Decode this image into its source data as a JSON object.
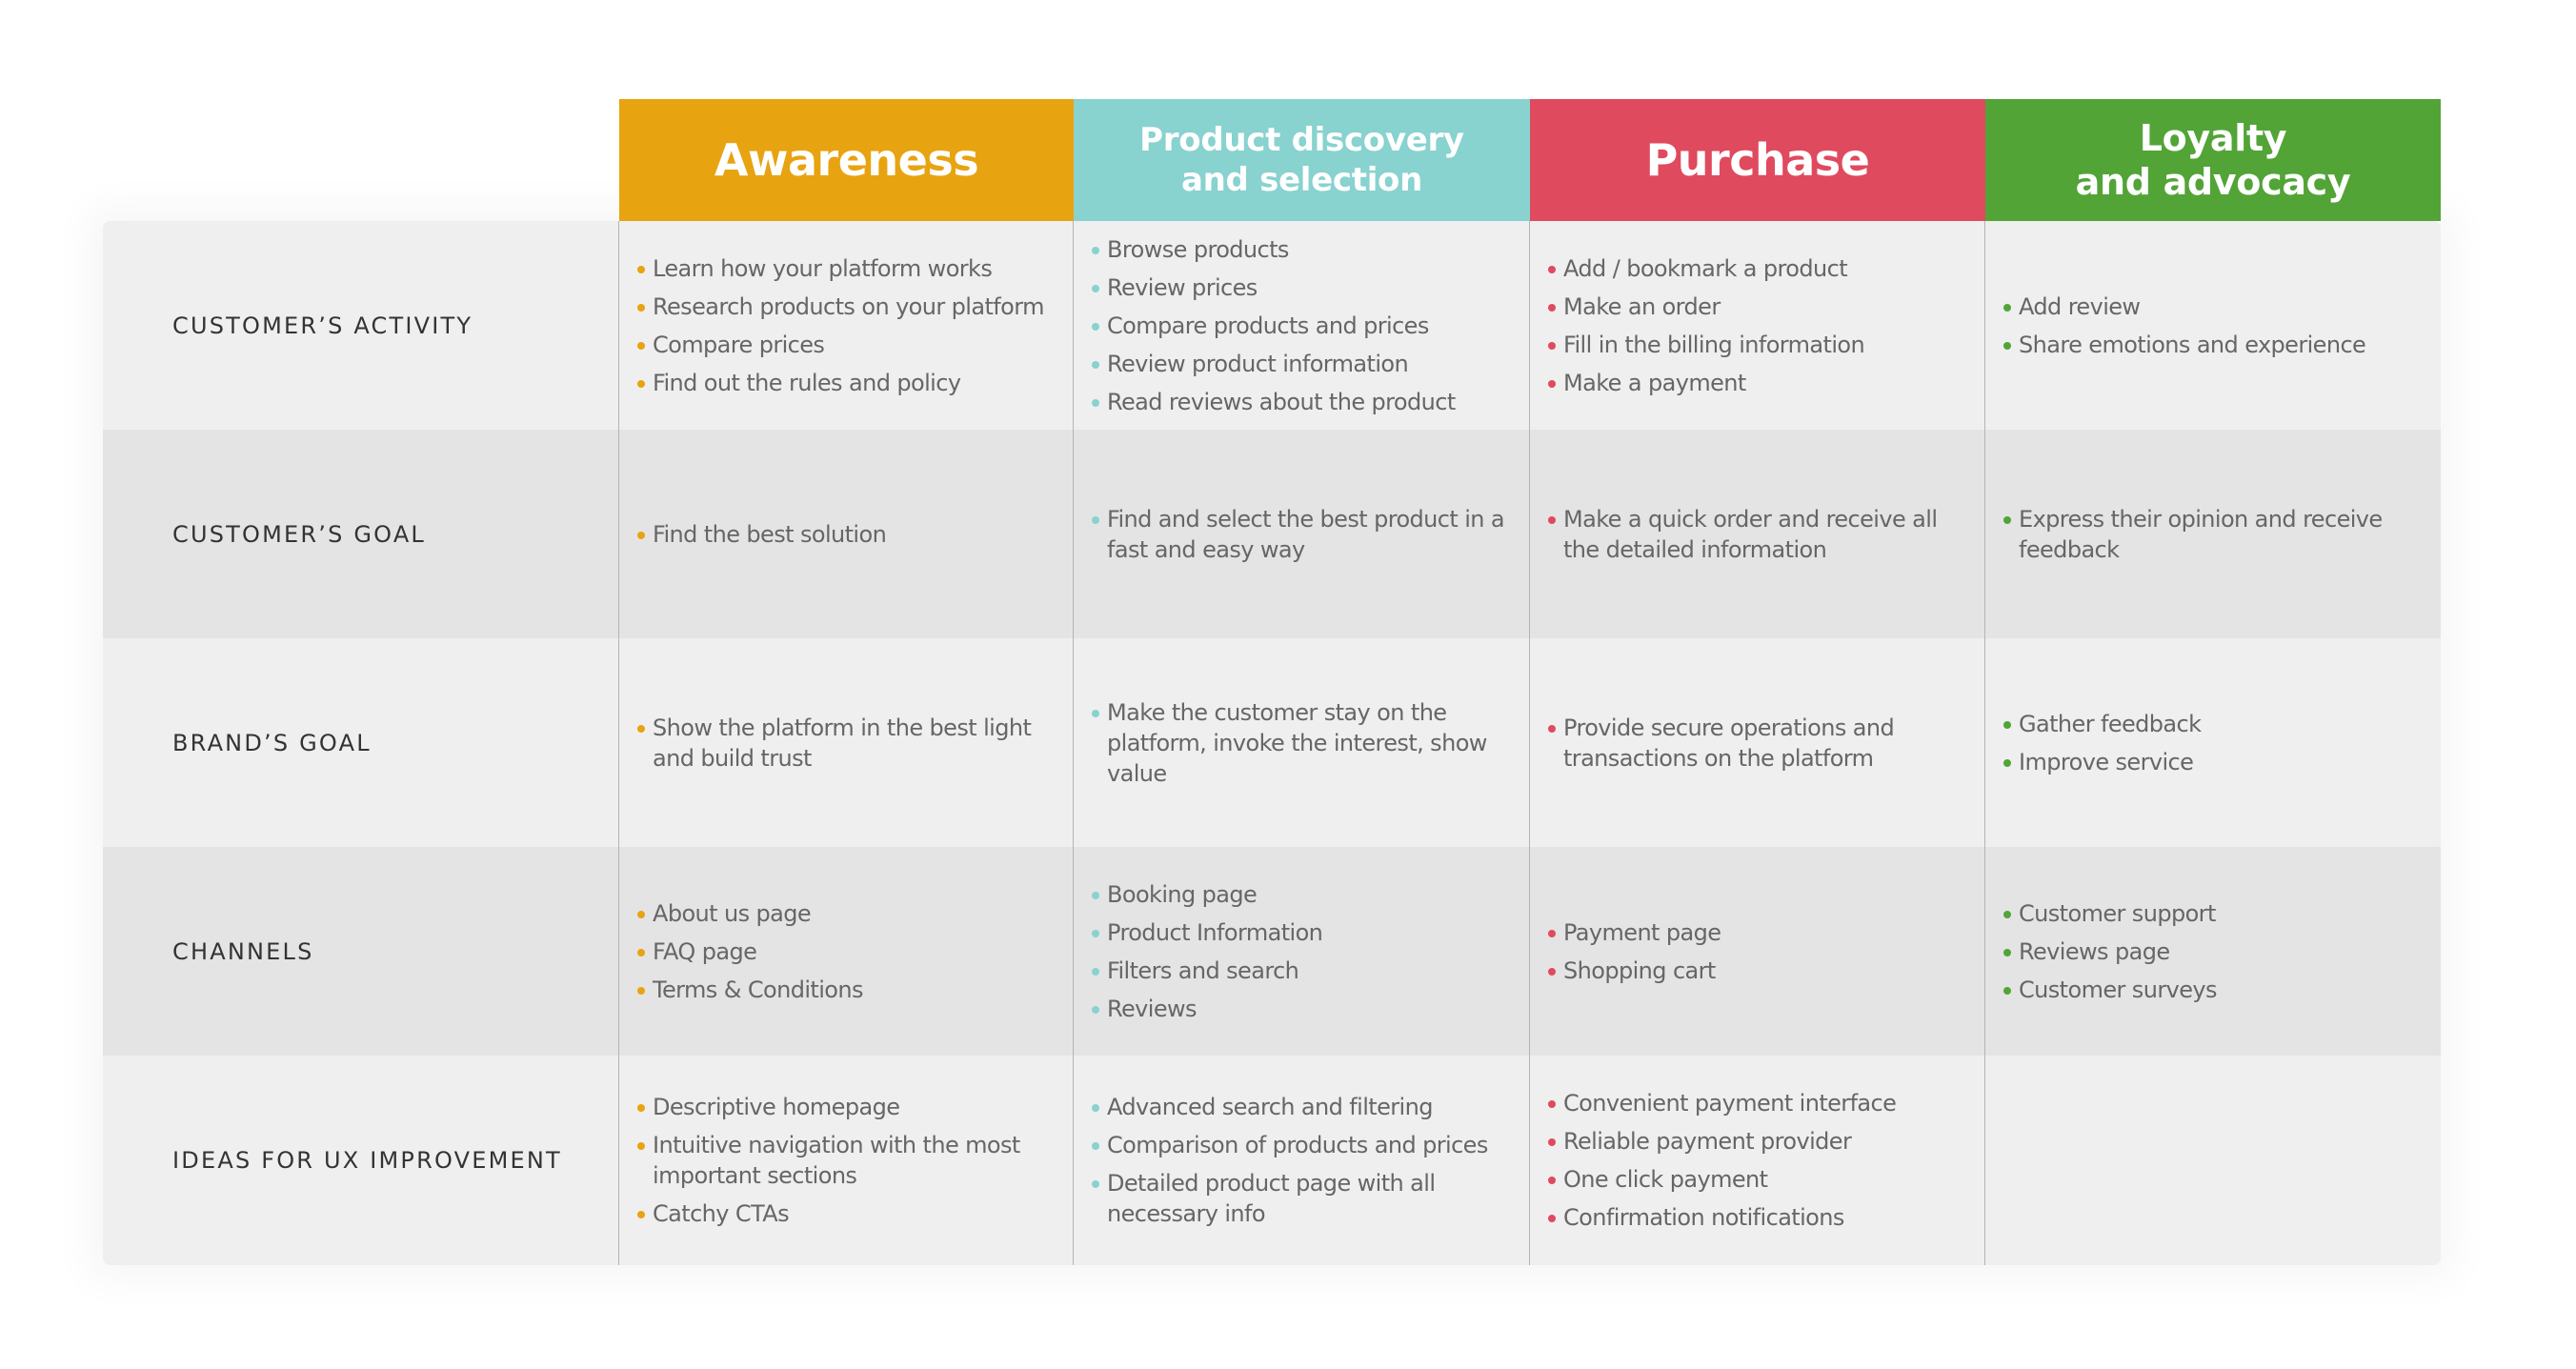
{
  "stages": [
    {
      "id": "awareness",
      "title": "Awareness",
      "color": "#e8a311",
      "size": "xl"
    },
    {
      "id": "discovery",
      "title": "Product discovery\nand selection",
      "color": "#88d2cf",
      "size": "md"
    },
    {
      "id": "purchase",
      "title": "Purchase",
      "color": "#e04a5e",
      "size": "xl"
    },
    {
      "id": "loyalty",
      "title": "Loyalty\nand advocacy",
      "color": "#52a437",
      "size": "lg"
    }
  ],
  "rows": [
    {
      "label": "CUSTOMER’S ACTIVITY",
      "cells": [
        [
          "Learn how your platform works",
          "Research products on your platform",
          "Compare prices",
          "Find out the rules and policy"
        ],
        [
          "Browse products",
          "Review prices",
          "Compare products and prices",
          "Review product information",
          "Read reviews about the product"
        ],
        [
          "Add / bookmark a product",
          "Make an order",
          "Fill in the billing information",
          "Make a payment"
        ],
        [
          "Add review",
          "Share emotions and experience"
        ]
      ]
    },
    {
      "label": "CUSTOMER’S GOAL",
      "cells": [
        [
          "Find the best solution"
        ],
        [
          "Find and select the best product in a fast and easy way"
        ],
        [
          "Make a quick order and receive all the detailed information"
        ],
        [
          "Express their opinion and receive feedback"
        ]
      ]
    },
    {
      "label": "BRAND’S GOAL",
      "cells": [
        [
          "Show the platform in the best light and build trust"
        ],
        [
          "Make the customer stay on the platform, invoke the interest, show value"
        ],
        [
          "Provide secure operations and transactions on the platform"
        ],
        [
          "Gather feedback",
          "Improve service"
        ]
      ]
    },
    {
      "label": "CHANNELS",
      "cells": [
        [
          "About us page",
          "FAQ page",
          "Terms & Conditions"
        ],
        [
          "Booking page",
          "Product Information",
          "Filters and search",
          "Reviews"
        ],
        [
          "Payment page",
          "Shopping cart"
        ],
        [
          "Customer support",
          "Reviews page",
          "Customer surveys"
        ]
      ]
    },
    {
      "label": "IDEAS FOR UX IMPROVEMENT",
      "cells": [
        [
          "Descriptive homepage",
          "Intuitive navigation with the most important sections",
          "Catchy CTAs"
        ],
        [
          "Advanced search and filtering",
          "Comparison of products and prices",
          "Detailed product page with all necessary info"
        ],
        [
          "Convenient payment interface",
          "Reliable payment provider",
          "One click payment",
          "Confirmation notifications"
        ],
        []
      ]
    }
  ],
  "colors": {
    "row_light": "#efefef",
    "row_dark": "#e4e4e4",
    "label_text": "#333333",
    "item_text": "#666666",
    "divider": "#b4b4b4"
  }
}
